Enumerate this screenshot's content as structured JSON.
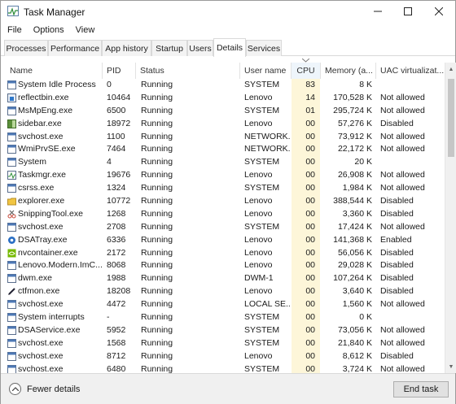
{
  "window": {
    "title": "Task Manager"
  },
  "menu": [
    "File",
    "Options",
    "View"
  ],
  "tabs": [
    "Processes",
    "Performance",
    "App history",
    "Startup",
    "Users",
    "Details",
    "Services"
  ],
  "active_tab": "Details",
  "columns": {
    "name": "Name",
    "pid": "PID",
    "status": "Status",
    "user": "User name",
    "cpu": "CPU",
    "memory": "Memory (a...",
    "uac": "UAC virtualizat..."
  },
  "sorted_column": "cpu",
  "processes": [
    {
      "name": "System Idle Process",
      "pid": "0",
      "status": "Running",
      "user": "SYSTEM",
      "cpu": "83",
      "memory": "8 K",
      "uac": "",
      "icon": "window-icon"
    },
    {
      "name": "reflectbin.exe",
      "pid": "10464",
      "status": "Running",
      "user": "Lenovo",
      "cpu": "14",
      "memory": "170,528 K",
      "uac": "Not allowed",
      "icon": "app-icon"
    },
    {
      "name": "MsMpEng.exe",
      "pid": "6500",
      "status": "Running",
      "user": "SYSTEM",
      "cpu": "01",
      "memory": "295,724 K",
      "uac": "Not allowed",
      "icon": "window-icon"
    },
    {
      "name": "sidebar.exe",
      "pid": "18972",
      "status": "Running",
      "user": "Lenovo",
      "cpu": "00",
      "memory": "57,276 K",
      "uac": "Disabled",
      "icon": "sidebar-icon"
    },
    {
      "name": "svchost.exe",
      "pid": "1100",
      "status": "Running",
      "user": "NETWORK...",
      "cpu": "00",
      "memory": "73,912 K",
      "uac": "Not allowed",
      "icon": "window-icon"
    },
    {
      "name": "WmiPrvSE.exe",
      "pid": "7464",
      "status": "Running",
      "user": "NETWORK...",
      "cpu": "00",
      "memory": "22,172 K",
      "uac": "Not allowed",
      "icon": "window-icon"
    },
    {
      "name": "System",
      "pid": "4",
      "status": "Running",
      "user": "SYSTEM",
      "cpu": "00",
      "memory": "20 K",
      "uac": "",
      "icon": "window-icon"
    },
    {
      "name": "Taskmgr.exe",
      "pid": "19676",
      "status": "Running",
      "user": "Lenovo",
      "cpu": "00",
      "memory": "26,908 K",
      "uac": "Not allowed",
      "icon": "taskmgr-icon"
    },
    {
      "name": "csrss.exe",
      "pid": "1324",
      "status": "Running",
      "user": "SYSTEM",
      "cpu": "00",
      "memory": "1,984 K",
      "uac": "Not allowed",
      "icon": "window-icon"
    },
    {
      "name": "explorer.exe",
      "pid": "10772",
      "status": "Running",
      "user": "Lenovo",
      "cpu": "00",
      "memory": "388,544 K",
      "uac": "Disabled",
      "icon": "folder-icon"
    },
    {
      "name": "SnippingTool.exe",
      "pid": "1268",
      "status": "Running",
      "user": "Lenovo",
      "cpu": "00",
      "memory": "3,360 K",
      "uac": "Disabled",
      "icon": "scissors-icon"
    },
    {
      "name": "svchost.exe",
      "pid": "2708",
      "status": "Running",
      "user": "SYSTEM",
      "cpu": "00",
      "memory": "17,424 K",
      "uac": "Not allowed",
      "icon": "window-icon"
    },
    {
      "name": "DSATray.exe",
      "pid": "6336",
      "status": "Running",
      "user": "Lenovo",
      "cpu": "00",
      "memory": "141,368 K",
      "uac": "Enabled",
      "icon": "gear-icon"
    },
    {
      "name": "nvcontainer.exe",
      "pid": "2172",
      "status": "Running",
      "user": "Lenovo",
      "cpu": "00",
      "memory": "56,056 K",
      "uac": "Disabled",
      "icon": "nvidia-icon"
    },
    {
      "name": "Lenovo.Modern.ImC...",
      "pid": "8068",
      "status": "Running",
      "user": "Lenovo",
      "cpu": "00",
      "memory": "29,028 K",
      "uac": "Disabled",
      "icon": "window-icon"
    },
    {
      "name": "dwm.exe",
      "pid": "1988",
      "status": "Running",
      "user": "DWM-1",
      "cpu": "00",
      "memory": "107,264 K",
      "uac": "Disabled",
      "icon": "window-icon"
    },
    {
      "name": "ctfmon.exe",
      "pid": "18208",
      "status": "Running",
      "user": "Lenovo",
      "cpu": "00",
      "memory": "3,640 K",
      "uac": "Disabled",
      "icon": "pen-icon"
    },
    {
      "name": "svchost.exe",
      "pid": "4472",
      "status": "Running",
      "user": "LOCAL SE...",
      "cpu": "00",
      "memory": "1,560 K",
      "uac": "Not allowed",
      "icon": "window-icon"
    },
    {
      "name": "System interrupts",
      "pid": "-",
      "status": "Running",
      "user": "SYSTEM",
      "cpu": "00",
      "memory": "0 K",
      "uac": "",
      "icon": "window-icon"
    },
    {
      "name": "DSAService.exe",
      "pid": "5952",
      "status": "Running",
      "user": "SYSTEM",
      "cpu": "00",
      "memory": "73,056 K",
      "uac": "Not allowed",
      "icon": "window-icon"
    },
    {
      "name": "svchost.exe",
      "pid": "1568",
      "status": "Running",
      "user": "SYSTEM",
      "cpu": "00",
      "memory": "21,840 K",
      "uac": "Not allowed",
      "icon": "window-icon"
    },
    {
      "name": "svchost.exe",
      "pid": "8712",
      "status": "Running",
      "user": "Lenovo",
      "cpu": "00",
      "memory": "8,612 K",
      "uac": "Disabled",
      "icon": "window-icon"
    },
    {
      "name": "svchost.exe",
      "pid": "6480",
      "status": "Running",
      "user": "SYSTEM",
      "cpu": "00",
      "memory": "3,724 K",
      "uac": "Not allowed",
      "icon": "window-icon"
    }
  ],
  "footer": {
    "fewer_details": "Fewer details",
    "end_task": "End task"
  },
  "colors": {
    "cpu_highlight": "#fdf6d9",
    "sorted_header": "#eef5fb",
    "footer_bg": "#f0f0f0"
  }
}
